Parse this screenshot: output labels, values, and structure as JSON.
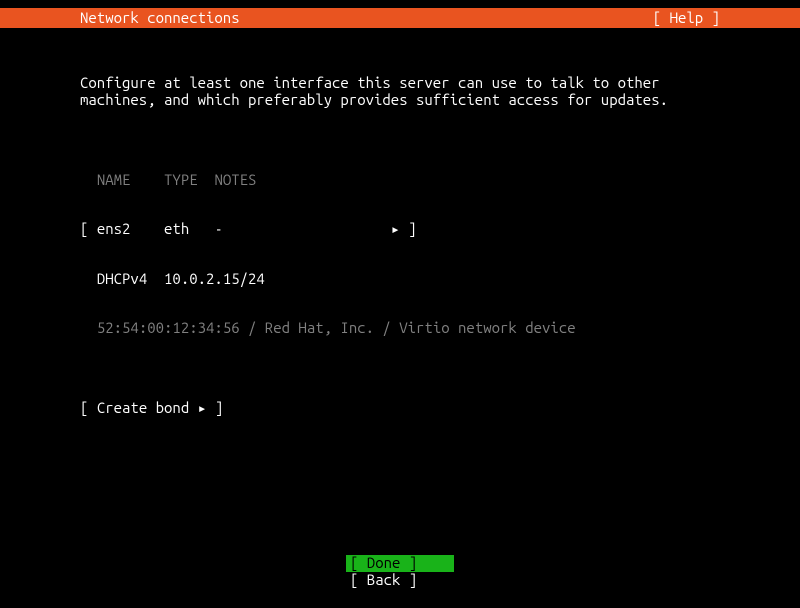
{
  "header": {
    "title": "Network connections",
    "help": "[ Help ]"
  },
  "description": "Configure at least one interface this server can use to talk to other machines, and which preferably provides sufficient access for updates.",
  "table": {
    "headers": {
      "name": "NAME",
      "type": "TYPE",
      "notes": "NOTES"
    },
    "row": {
      "name": "ens2",
      "type": "eth",
      "notes": "-",
      "arrow": "▸"
    },
    "dhcp": {
      "label": "DHCPv4",
      "address": "10.0.2.15/24"
    },
    "hwinfo": "52:54:00:12:34:56 / Red Hat, Inc. / Virtio network device"
  },
  "create_bond": {
    "label": "Create bond",
    "arrow": "▸"
  },
  "footer": {
    "done": "Done",
    "back": "Back"
  }
}
